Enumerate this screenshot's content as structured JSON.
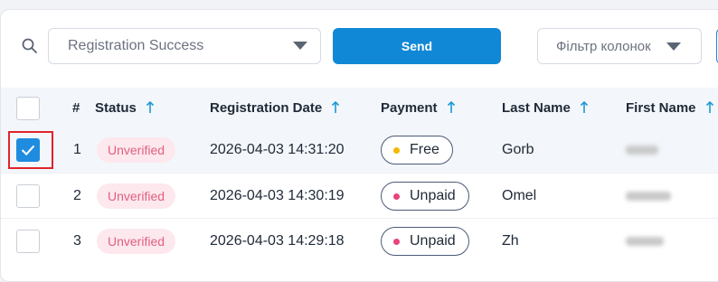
{
  "toolbar": {
    "search_icon": "search-icon",
    "select_value": "Registration Success",
    "send_label": "Send",
    "filter_label": "Фільтр колонок"
  },
  "table": {
    "columns": [
      {
        "key": "number",
        "label": "#"
      },
      {
        "key": "status",
        "label": "Status"
      },
      {
        "key": "registration_date",
        "label": "Registration Date"
      },
      {
        "key": "payment",
        "label": "Payment"
      },
      {
        "key": "last_name",
        "label": "Last Name"
      },
      {
        "key": "first_name",
        "label": "First Name"
      }
    ],
    "rows": [
      {
        "checked": true,
        "number": "1",
        "status": "Unverified",
        "registration_date": "2026-04-03 14:31:20",
        "payment": "Free",
        "last_name": "Gorb",
        "first_name_blurred": true
      },
      {
        "checked": false,
        "number": "2",
        "status": "Unverified",
        "registration_date": "2026-04-03 14:30:19",
        "payment": "Unpaid",
        "last_name": "Omel",
        "first_name_blurred": true
      },
      {
        "checked": false,
        "number": "3",
        "status": "Unverified",
        "registration_date": "2026-04-03 14:29:18",
        "payment": "Unpaid",
        "last_name": "Zh",
        "first_name_blurred": true
      }
    ]
  },
  "colors": {
    "accent": "#1188d6",
    "checkbox_checked": "#1f8ce0",
    "highlight_border": "#e0242b",
    "badge_bg": "#fde8ee",
    "badge_text": "#e0607f",
    "free_dot": "#f5b800",
    "unpaid_dot": "#e8437b",
    "sort_arrow": "#1a9ad6"
  }
}
